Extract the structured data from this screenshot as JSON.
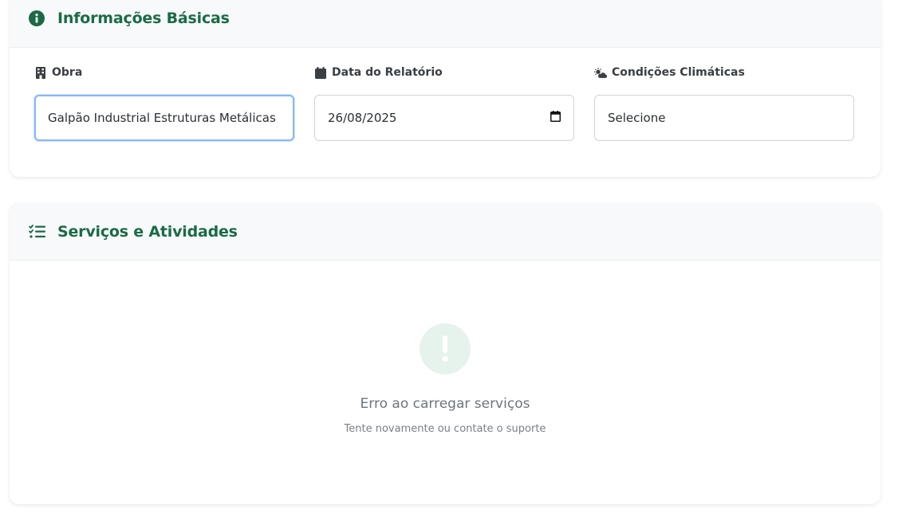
{
  "basic_info": {
    "title": "Informações Básicas",
    "fields": {
      "obra": {
        "label": "Obra",
        "value": "Galpão Industrial Estruturas Metálicas"
      },
      "data": {
        "label": "Data do Relatório",
        "value": "26/08/2025"
      },
      "clima": {
        "label": "Condições Climáticas",
        "value": "Selecione"
      }
    }
  },
  "services": {
    "title": "Serviços e Atividades",
    "error_title": "Erro ao carregar serviços",
    "error_subtitle": "Tente novamente ou contate o suporte"
  },
  "colors": {
    "accent": "#1a6b45",
    "focus": "#86b7fe",
    "error_bg": "#e6f2ec"
  }
}
